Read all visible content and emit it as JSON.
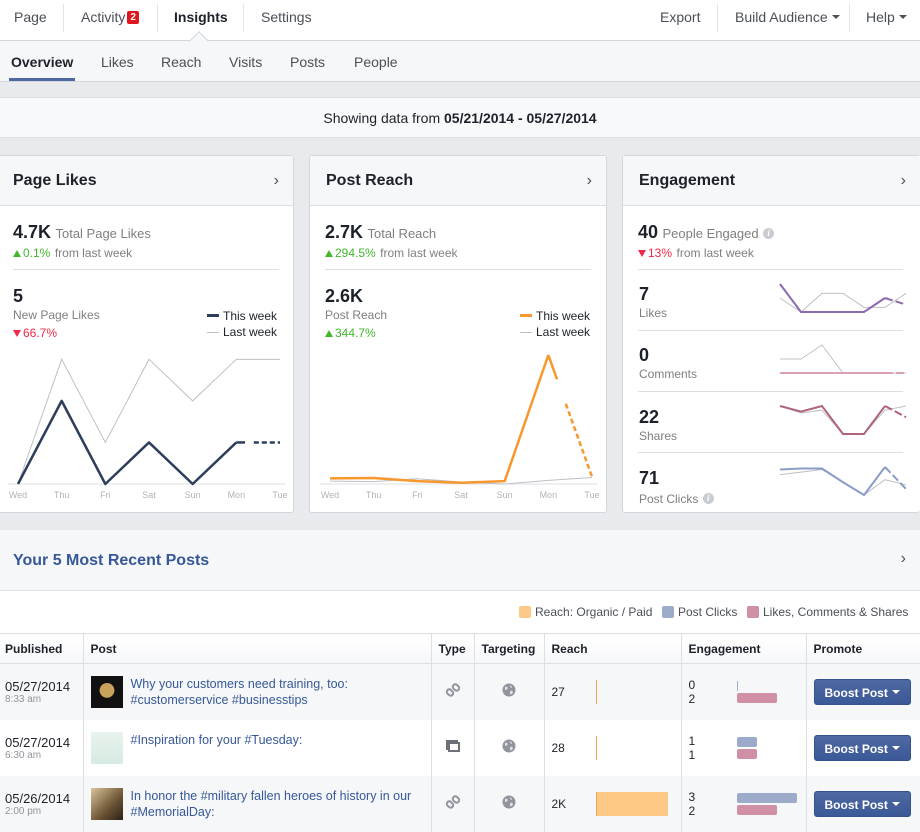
{
  "topnav": {
    "page": "Page",
    "activity": "Activity",
    "activity_badge": "2",
    "insights": "Insights",
    "settings": "Settings",
    "export": "Export",
    "build_audience": "Build Audience",
    "help": "Help"
  },
  "subnav": {
    "tabs": [
      "Overview",
      "Likes",
      "Reach",
      "Visits",
      "Posts",
      "People"
    ],
    "active": "Overview"
  },
  "daterange": {
    "prefix": "Showing data from",
    "range": "05/21/2014 - 05/27/2014"
  },
  "colors": {
    "this_week_likes": "#2d3d5c",
    "this_week_reach": "#f7982e",
    "last_week": "#bcc0c6",
    "eng_likes": "#8c6ab0",
    "eng_comments": "#d8a0b2",
    "eng_shares": "#b0647a",
    "eng_clicks": "#8b9dc7",
    "accent": "#4e69a2"
  },
  "page_likes": {
    "title": "Page Likes",
    "total": "4.7K",
    "total_label": "Total Page Likes",
    "change": "0.1%",
    "change_suffix": "from last week",
    "new_value": "5",
    "new_label": "New Page Likes",
    "new_change": "66.7%",
    "legend_this": "This week",
    "legend_last": "Last week"
  },
  "post_reach": {
    "title": "Post Reach",
    "total": "2.7K",
    "total_label": "Total Reach",
    "change": "294.5%",
    "change_suffix": "from last week",
    "sub_value": "2.6K",
    "sub_label": "Post Reach",
    "sub_change": "344.7%",
    "legend_this": "This week",
    "legend_last": "Last week"
  },
  "engagement": {
    "title": "Engagement",
    "total": "40",
    "total_label": "People Engaged",
    "change": "13%",
    "change_suffix": "from last week",
    "rows": [
      {
        "value": "7",
        "label": "Likes"
      },
      {
        "value": "0",
        "label": "Comments"
      },
      {
        "value": "22",
        "label": "Shares"
      },
      {
        "value": "71",
        "label": "Post Clicks"
      }
    ]
  },
  "chart_data": [
    {
      "type": "line",
      "title": "New Page Likes",
      "categories": [
        "Wed",
        "Thu",
        "Fri",
        "Sat",
        "Sun",
        "Mon",
        "Tue"
      ],
      "series": [
        {
          "name": "This week",
          "values": [
            0,
            2,
            0,
            1,
            0,
            1,
            1
          ],
          "projected_last": true
        },
        {
          "name": "Last week",
          "values": [
            0,
            3,
            1,
            3,
            2,
            3,
            3
          ]
        }
      ],
      "ylim": [
        0,
        3.2
      ]
    },
    {
      "type": "line",
      "title": "Post Reach",
      "categories": [
        "Wed",
        "Thu",
        "Fri",
        "Sat",
        "Sun",
        "Mon",
        "Tue"
      ],
      "series": [
        {
          "name": "This week",
          "values": [
            0.14,
            0.15,
            0.07,
            0.03,
            0.07,
            3.2,
            0.18
          ],
          "projected_last": true
        },
        {
          "name": "Last week",
          "values": [
            0.07,
            0.06,
            0.13,
            0.05,
            0.0,
            0.09,
            0.16
          ]
        }
      ],
      "ylim": [
        0,
        3.3
      ]
    },
    {
      "type": "line",
      "title": "Likes",
      "series": [
        {
          "name": "This week",
          "values": [
            4,
            1,
            1,
            1,
            1,
            2.5,
            1.8
          ]
        },
        {
          "name": "Last week",
          "values": [
            2.5,
            1,
            3,
            3,
            1.5,
            1.5,
            3
          ]
        }
      ]
    },
    {
      "type": "line",
      "title": "Comments",
      "series": [
        {
          "name": "This week",
          "values": [
            0,
            0,
            0,
            0,
            0,
            0,
            0
          ]
        },
        {
          "name": "Last week",
          "values": [
            1,
            1,
            2,
            0,
            0,
            0,
            0
          ]
        }
      ]
    },
    {
      "type": "line",
      "title": "Shares",
      "series": [
        {
          "name": "This week",
          "values": [
            4,
            3.6,
            4,
            2,
            2,
            4,
            3.2
          ]
        },
        {
          "name": "Last week",
          "values": [
            4,
            3.5,
            3.7,
            2,
            2,
            3.7,
            4
          ]
        }
      ]
    },
    {
      "type": "line",
      "title": "Post Clicks",
      "series": [
        {
          "name": "This week",
          "values": [
            13,
            13.2,
            13.2,
            10.5,
            8,
            13.5,
            9.2
          ]
        },
        {
          "name": "Last week",
          "values": [
            12,
            12.5,
            13,
            10.5,
            8,
            11,
            10
          ]
        }
      ]
    }
  ],
  "recent": {
    "title": "Your 5 Most Recent Posts",
    "legend": [
      "Reach: Organic / Paid",
      "Post Clicks",
      "Likes, Comments & Shares"
    ],
    "columns": [
      "Published",
      "Post",
      "Type",
      "Targeting",
      "Reach",
      "Engagement",
      "Promote"
    ],
    "rows": [
      {
        "date": "05/27/2014",
        "time": "8:33 am",
        "text": "Why your customers need training, too: #customerservice #businesstips",
        "type": "link-icon",
        "reach": "27",
        "reach_frac": 0.01,
        "clicks": "0",
        "lcs": "2",
        "clicks_frac": 0.0,
        "lcs_frac": 0.67,
        "button": "Boost Post"
      },
      {
        "date": "05/27/2014",
        "time": "6:30 am",
        "text": "#Inspiration for your #Tuesday:",
        "type": "album-icon",
        "reach": "28",
        "reach_frac": 0.01,
        "clicks": "1",
        "lcs": "1",
        "clicks_frac": 0.33,
        "lcs_frac": 0.33,
        "button": "Boost Post"
      },
      {
        "date": "05/26/2014",
        "time": "2:00 pm",
        "text": "In honor the #military fallen heroes of history in our #MemorialDay:",
        "type": "link-icon",
        "reach": "2K",
        "reach_frac": 1.0,
        "clicks": "3",
        "lcs": "2",
        "clicks_frac": 1.0,
        "lcs_frac": 0.67,
        "button": "Boost Post"
      }
    ]
  }
}
